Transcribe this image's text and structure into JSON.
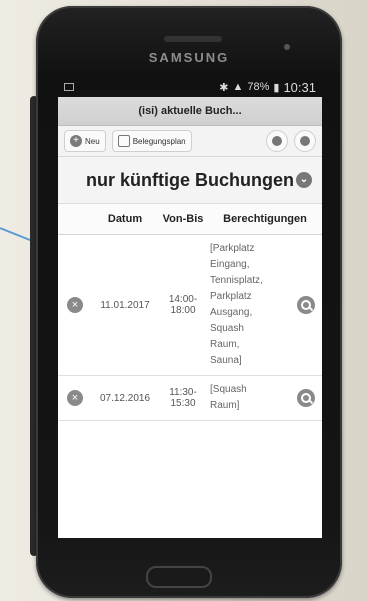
{
  "device": {
    "brand": "SAMSUNG"
  },
  "statusbar": {
    "time": "10:31",
    "battery": "78%"
  },
  "titlebar": {
    "title": "(isi) aktuelle Buch..."
  },
  "toolbar": {
    "new_label": "Neu",
    "plan_label": "Belegungsplan"
  },
  "filter": {
    "title": "nur künftige Buchungen"
  },
  "table": {
    "headers": {
      "date": "Datum",
      "time": "Von-Bis",
      "permissions": "Berechtigungen"
    },
    "rows": [
      {
        "date": "11.01.2017",
        "time_from": "14:00-",
        "time_to": "18:00",
        "permissions": [
          "[Parkplatz",
          "Eingang,",
          "Tennisplatz,",
          "Parkplatz",
          "Ausgang,",
          "Squash",
          "Raum,",
          "Sauna]"
        ]
      },
      {
        "date": "07.12.2016",
        "time_from": "11:30-",
        "time_to": "15:30",
        "permissions": [
          "[Squash",
          "Raum]"
        ]
      }
    ]
  },
  "colors": {
    "accent_arrow": "#5b9bd5"
  }
}
